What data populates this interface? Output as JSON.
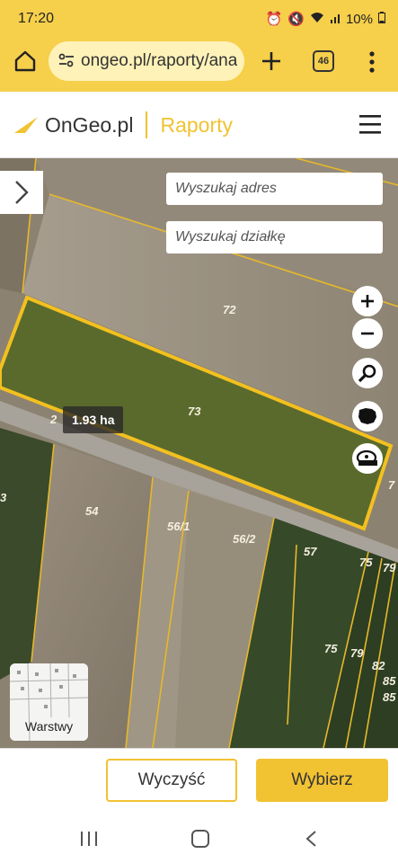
{
  "status": {
    "time": "17:20",
    "battery": "10%"
  },
  "browser": {
    "url": "ongeo.pl/raporty/ana",
    "tab_count": "46"
  },
  "app": {
    "brand": "OnGeo.pl",
    "section": "Raporty"
  },
  "map": {
    "search_address_placeholder": "Wyszukaj adres",
    "search_parcel_placeholder": "Wyszukaj działkę",
    "area_label": "1.93 ha",
    "layers_label": "Warstwy",
    "parcels": [
      "72",
      "73",
      "54",
      "56/1",
      "56/2",
      "57",
      "75",
      "79",
      "75",
      "79",
      "82",
      "85",
      "85",
      "7",
      "3",
      "2"
    ]
  },
  "actions": {
    "clear": "Wyczyść",
    "choose": "Wybierz"
  },
  "colors": {
    "accent": "#f1c232",
    "toolbar": "#f6cf4b"
  }
}
